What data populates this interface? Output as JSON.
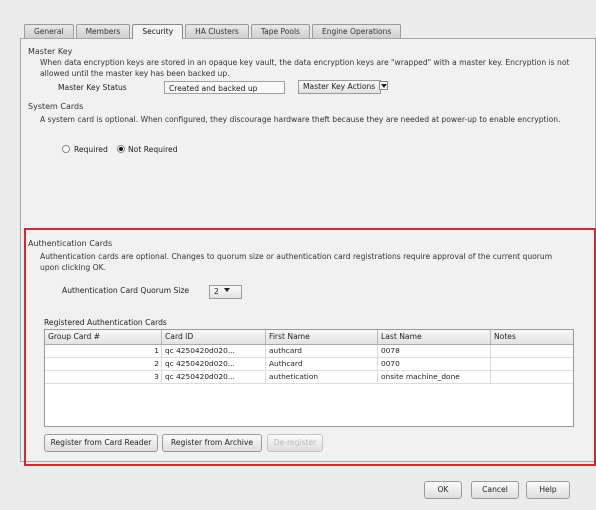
{
  "tabs": [
    {
      "label": "General"
    },
    {
      "label": "Members"
    },
    {
      "label": "Security"
    },
    {
      "label": "HA Clusters"
    },
    {
      "label": "Tape Pools"
    },
    {
      "label": "Engine Operations"
    }
  ],
  "master_key": {
    "title": "Master Key",
    "description": "When data encryption keys are stored in an opaque key vault, the data encryption keys are \"wrapped\" with a master key. Encryption is not allowed until the master key has been backed up.",
    "status_label": "Master Key Status",
    "status_value": "Created and backed up",
    "actions_label": "Master Key Actions"
  },
  "system_cards": {
    "title": "System Cards",
    "description": "A system card is optional. When configured, they discourage hardware theft because they are needed at power-up to enable encryption.",
    "required_label": "Required",
    "not_required_label": "Not Required",
    "selected": "not_required"
  },
  "auth_cards": {
    "title": "Authentication Cards",
    "description": "Authentication cards are optional. Changes to quorum size or authentication card registrations require approval of the current quorum upon clicking OK.",
    "quorum_label": "Authentication Card Quorum Size",
    "quorum_value": "2",
    "registered_title": "Registered Authentication Cards",
    "columns": [
      "Group Card #",
      "Card ID",
      "First Name",
      "Last Name",
      "Notes"
    ],
    "rows": [
      {
        "group": "1",
        "card_id": "qc 4250420d020...",
        "first": "authcard",
        "last": "0078",
        "notes": ""
      },
      {
        "group": "2",
        "card_id": "qc 4250420d020...",
        "first": "Authcard",
        "last": "0070",
        "notes": ""
      },
      {
        "group": "3",
        "card_id": "qc 4250420d020...",
        "first": "authetication",
        "last": "onsite machine_done",
        "notes": ""
      }
    ],
    "register_reader_label": "Register from Card Reader",
    "register_archive_label": "Register from Archive",
    "deregister_label": "De-register"
  },
  "footer": {
    "ok_label": "OK",
    "cancel_label": "Cancel",
    "help_label": "Help"
  },
  "colors": {
    "highlight": "#d9262c"
  }
}
